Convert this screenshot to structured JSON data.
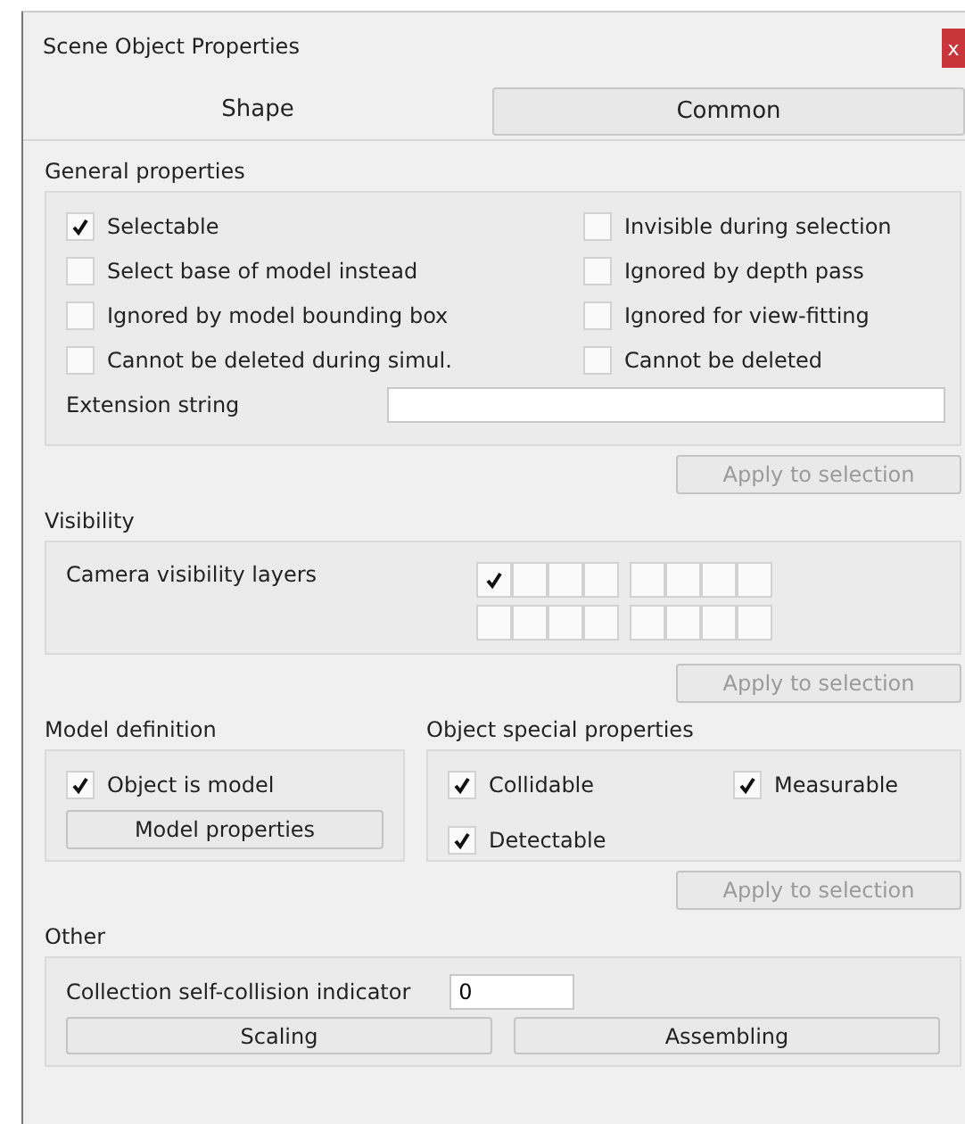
{
  "window": {
    "title": "Scene Object Properties",
    "close": "x"
  },
  "tabs": [
    {
      "label": "Shape",
      "selected": true
    },
    {
      "label": "Common",
      "selected": false
    }
  ],
  "general": {
    "title": "General properties",
    "checkboxes": [
      {
        "label": "Selectable",
        "checked": true
      },
      {
        "label": "Invisible during selection",
        "checked": false
      },
      {
        "label": "Select base of model instead",
        "checked": false
      },
      {
        "label": "Ignored by depth pass",
        "checked": false
      },
      {
        "label": "Ignored by model bounding  box",
        "checked": false
      },
      {
        "label": "Ignored for view-fitting",
        "checked": false
      },
      {
        "label": "Cannot be deleted during simul.",
        "checked": false
      },
      {
        "label": "Cannot be deleted",
        "checked": false
      }
    ],
    "extension": {
      "label": "Extension string"
    },
    "apply": {
      "label": "Apply to selection",
      "disabled": true
    }
  },
  "visibility": {
    "title": "Visibility",
    "layers_label": "Camera visibility layers",
    "layers": [
      {
        "checked": true
      },
      {
        "checked": false
      },
      {
        "checked": false
      },
      {
        "checked": false
      },
      {
        "checked": false
      },
      {
        "checked": false
      },
      {
        "checked": false
      },
      {
        "checked": false
      },
      {
        "checked": false
      },
      {
        "checked": false
      },
      {
        "checked": false
      },
      {
        "checked": false
      },
      {
        "checked": false
      },
      {
        "checked": false
      },
      {
        "checked": false
      },
      {
        "checked": false
      }
    ],
    "apply": {
      "label": "Apply to selection",
      "disabled": true
    }
  },
  "model_definition": {
    "title": "Model definition",
    "checkbox": {
      "label": "Object is model",
      "checked": true
    },
    "button": "Model properties"
  },
  "special_properties": {
    "title": "Object special properties",
    "checkboxes": [
      {
        "label": "Collidable",
        "checked": true
      },
      {
        "label": "Measurable",
        "checked": true
      },
      {
        "label": "Detectable",
        "checked": true
      }
    ],
    "apply": {
      "label": "Apply to selection",
      "disabled": true
    }
  },
  "other": {
    "title": "Other",
    "indicator": {
      "label": "Collection self-collision indicator",
      "value": "0"
    },
    "buttons": [
      "Scaling",
      "Assembling"
    ]
  }
}
